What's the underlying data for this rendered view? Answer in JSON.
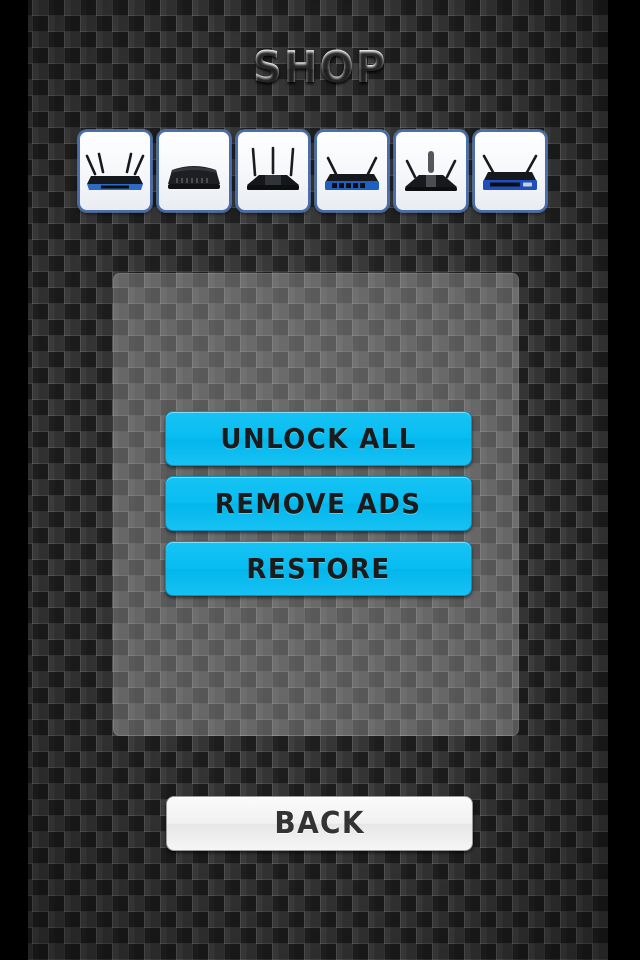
{
  "screen": {
    "title": "SHOP",
    "background_color": "#2b2b2b",
    "letterbox_color": "#000000",
    "accent_color": "#0ABDF2"
  },
  "thumbnails": {
    "items": [
      {
        "name": "router-blue-four-antenna",
        "body_color": "#2E6BC4",
        "accent": "#111418",
        "antennas": 4,
        "style": "blue-flat"
      },
      {
        "name": "router-black-no-antenna",
        "body_color": "#1d1f22",
        "accent": "#2a2d31",
        "antennas": 0,
        "style": "black-dome"
      },
      {
        "name": "router-black-three-antenna",
        "body_color": "#15171a",
        "accent": "#303338",
        "antennas": 3,
        "style": "black-angular"
      },
      {
        "name": "router-blue-two-antenna",
        "body_color": "#1f5fc0",
        "accent": "#0e1114",
        "antennas": 2,
        "style": "blue-ports"
      },
      {
        "name": "router-black-three-tall",
        "body_color": "#17191c",
        "accent": "#53565b",
        "antennas": 3,
        "style": "black-wide"
      },
      {
        "name": "router-blue-classic-wrt",
        "body_color": "#1f4fbf",
        "accent": "#111418",
        "antennas": 2,
        "style": "blue-classic"
      }
    ]
  },
  "actions": {
    "buttons": [
      {
        "id": "unlock-all",
        "label": "UNLOCK  ALL"
      },
      {
        "id": "remove-ads",
        "label": "REMOVE  ADS"
      },
      {
        "id": "restore",
        "label": "RESTORE"
      }
    ]
  },
  "navigation": {
    "back_label": "BACK"
  }
}
